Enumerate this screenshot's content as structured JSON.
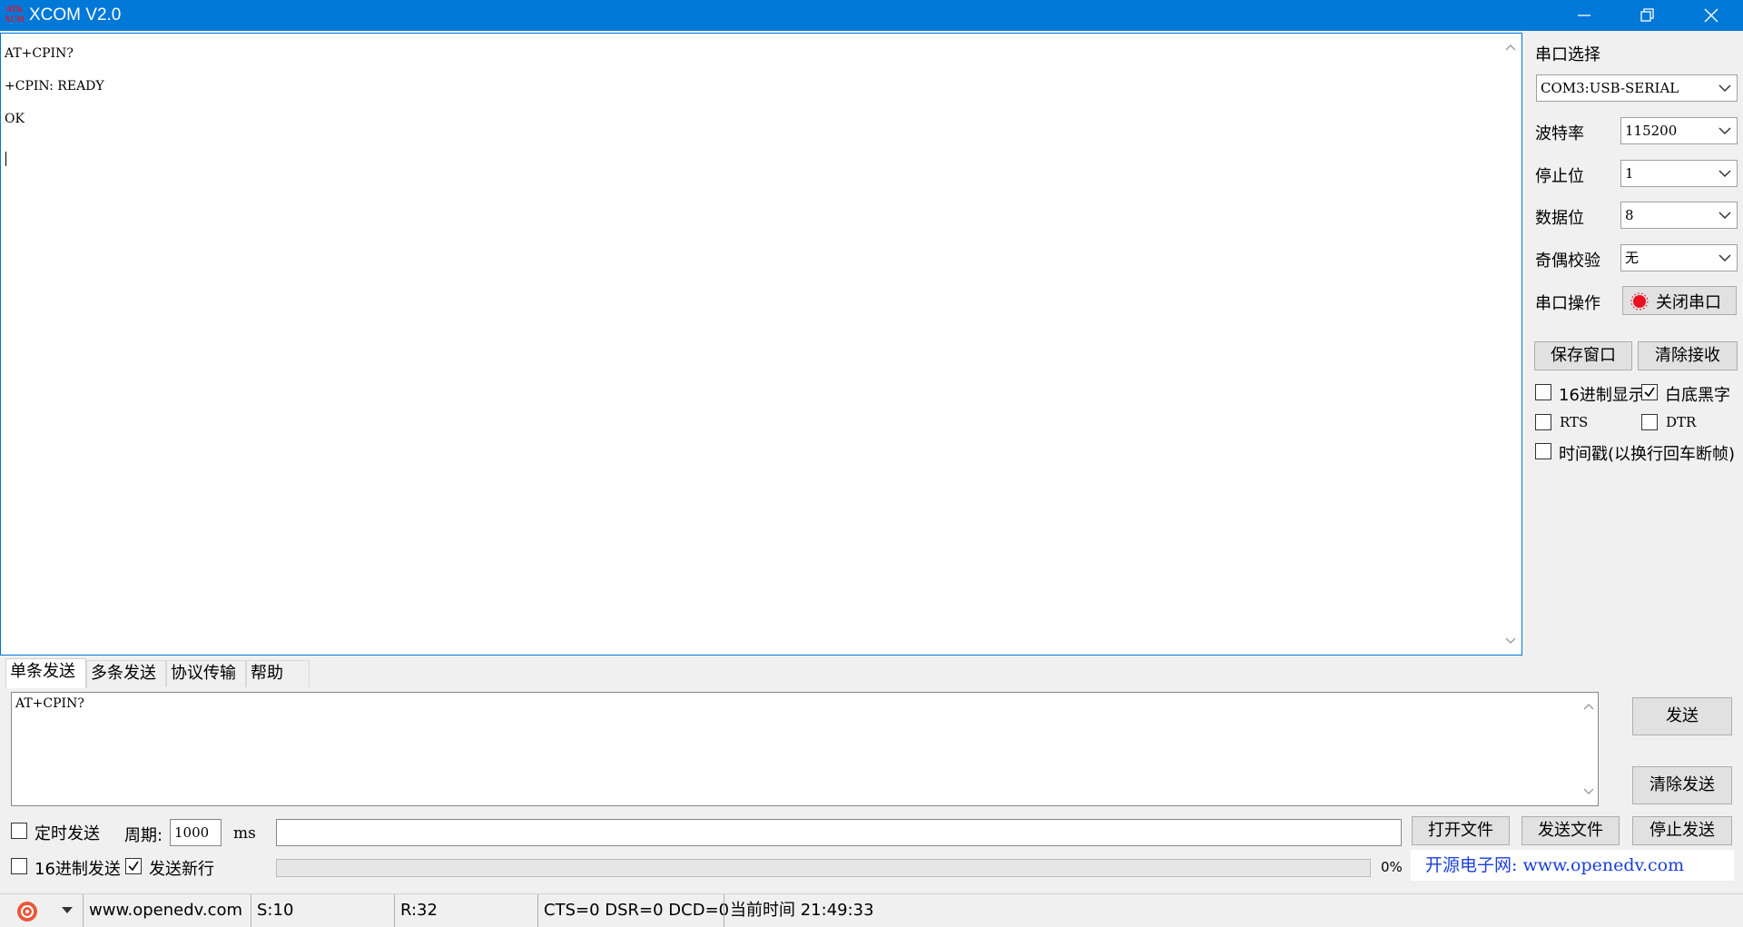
{
  "window": {
    "title": "XCOM V2.0",
    "logo_text": "ATK XCOM"
  },
  "receive": {
    "lines": [
      "AT+CPIN?",
      "+CPIN: READY",
      "OK"
    ]
  },
  "right": {
    "port_label": "串口选择",
    "port_value": "COM3:USB-SERIAL",
    "baud_label": "波特率",
    "baud_value": "115200",
    "stop_label": "停止位",
    "stop_value": "1",
    "data_label": "数据位",
    "data_value": "8",
    "parity_label": "奇偶校验",
    "parity_value": "无",
    "op_label": "串口操作",
    "close_port_label": "关闭串口",
    "save_window_label": "保存窗口",
    "clear_recv_label": "清除接收",
    "hex_display_label": "16进制显示",
    "hex_display_checked": false,
    "white_bg_label": "白底黑字",
    "white_bg_checked": true,
    "rts_label": "RTS",
    "rts_checked": false,
    "dtr_label": "DTR",
    "dtr_checked": false,
    "timestamp_label": "时间戳(以换行回车断帧)",
    "timestamp_checked": false
  },
  "tabs": [
    "单条发送",
    "多条发送",
    "协议传输",
    "帮助"
  ],
  "send": {
    "text": "AT+CPIN?",
    "send_label": "发送",
    "clear_send_label": "清除发送",
    "timed_send_label": "定时发送",
    "timed_send_checked": false,
    "period_label": "周期:",
    "period_value": "1000",
    "period_unit": "ms",
    "hex_send_label": "16进制发送",
    "hex_send_checked": false,
    "newline_label": "发送新行",
    "newline_checked": true,
    "open_file_label": "打开文件",
    "send_file_label": "发送文件",
    "stop_send_label": "停止发送",
    "progress_percent": "0%",
    "progress_value": 0,
    "banner": "开源电子网: www.openedv.com"
  },
  "status": {
    "url": "www.openedv.com",
    "sent": "S:10",
    "received": "R:32",
    "signals": "CTS=0 DSR=0 DCD=0",
    "time": "当前时间 21:49:33"
  },
  "colors": {
    "titlebar": "#0078d7",
    "banner_text": "#1a3fd8",
    "port_open_indicator": "#e81123"
  }
}
